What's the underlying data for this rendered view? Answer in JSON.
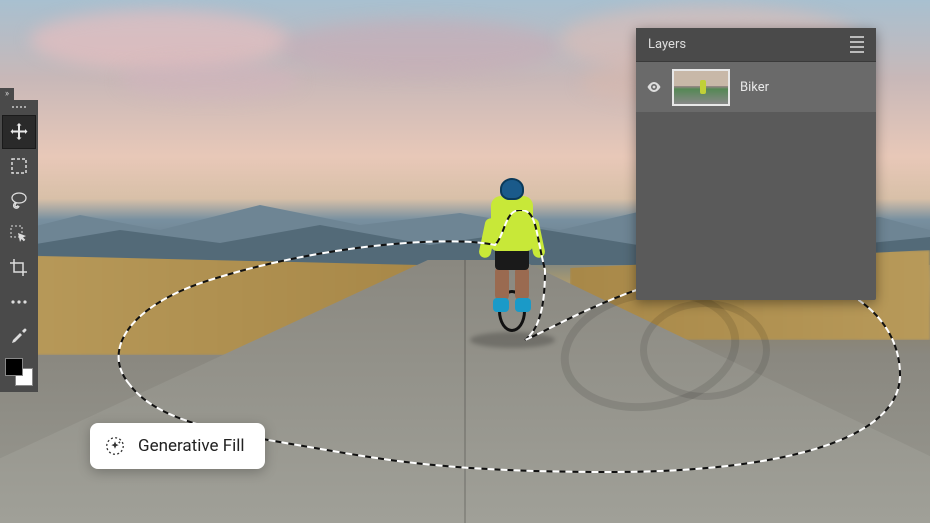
{
  "panel": {
    "title": "Layers",
    "layers": [
      {
        "name": "Biker",
        "visible": true
      }
    ]
  },
  "action_bar": {
    "button_label": "Generative Fill"
  },
  "tools": {
    "move": "move-tool",
    "marquee": "marquee-tool",
    "lasso": "lasso-tool",
    "select": "object-select-tool",
    "crop": "crop-tool",
    "more": "more-tools",
    "picker": "eyedropper-tool"
  },
  "colors": {
    "foreground": "#000000",
    "background": "#ffffff"
  }
}
